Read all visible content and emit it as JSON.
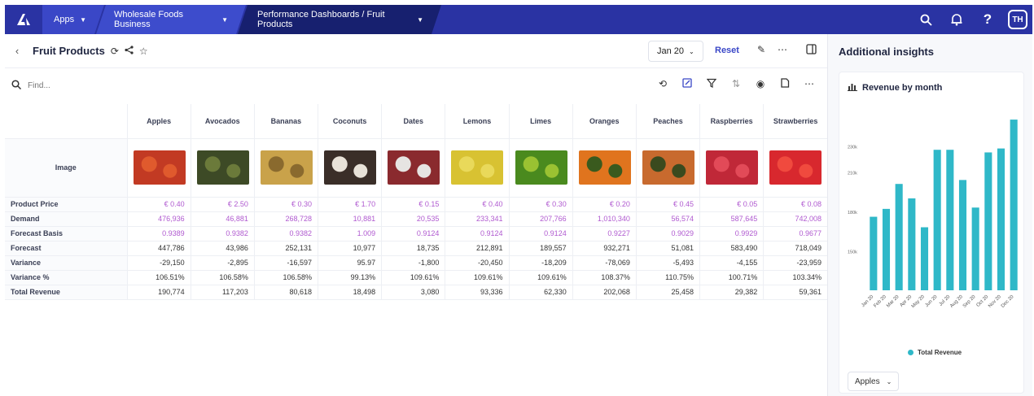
{
  "nav": {
    "apps": "Apps",
    "workspace": "Wholesale Foods Business",
    "dashboard": "Performance Dashboards / Fruit Products",
    "avatar": "TH"
  },
  "header": {
    "title": "Fruit Products",
    "date": "Jan 20",
    "reset": "Reset"
  },
  "toolbar": {
    "find_placeholder": "Find..."
  },
  "grid": {
    "columns": [
      "Apples",
      "Avocados",
      "Bananas",
      "Coconuts",
      "Dates",
      "Lemons",
      "Limes",
      "Oranges",
      "Peaches",
      "Raspberries",
      "Strawberries"
    ],
    "image_label": "Image",
    "image_colors": [
      [
        "#c23a23",
        "#e05a2d"
      ],
      [
        "#3d4a26",
        "#6b7a3a"
      ],
      [
        "#c9a24a",
        "#8a6a2e"
      ],
      [
        "#3a2e28",
        "#e8e2d8"
      ],
      [
        "#8a2a2e",
        "#e6e4e2"
      ],
      [
        "#d8c232",
        "#e9d95a"
      ],
      [
        "#4a8a1e",
        "#9ac232"
      ],
      [
        "#e0741e",
        "#3a5a1e"
      ],
      [
        "#c86a2e",
        "#3a4a1e"
      ],
      [
        "#c02838",
        "#e24a58"
      ],
      [
        "#d8282e",
        "#f04a3e"
      ]
    ],
    "rows": [
      {
        "label": "Product Price",
        "purple": true,
        "values": [
          "€ 0.40",
          "€ 2.50",
          "€ 0.30",
          "€ 1.70",
          "€ 0.15",
          "€ 0.40",
          "€ 0.30",
          "€ 0.20",
          "€ 0.45",
          "€ 0.05",
          "€ 0.08"
        ]
      },
      {
        "label": "Demand",
        "purple": true,
        "values": [
          "476,936",
          "46,881",
          "268,728",
          "10,881",
          "20,535",
          "233,341",
          "207,766",
          "1,010,340",
          "56,574",
          "587,645",
          "742,008"
        ]
      },
      {
        "label": "Forecast Basis",
        "purple": true,
        "values": [
          "0.9389",
          "0.9382",
          "0.9382",
          "1.009",
          "0.9124",
          "0.9124",
          "0.9124",
          "0.9227",
          "0.9029",
          "0.9929",
          "0.9677"
        ]
      },
      {
        "label": "Forecast",
        "purple": false,
        "values": [
          "447,786",
          "43,986",
          "252,131",
          "10,977",
          "18,735",
          "212,891",
          "189,557",
          "932,271",
          "51,081",
          "583,490",
          "718,049"
        ]
      },
      {
        "label": "Variance",
        "purple": false,
        "values": [
          "-29,150",
          "-2,895",
          "-16,597",
          "95.97",
          "-1,800",
          "-20,450",
          "-18,209",
          "-78,069",
          "-5,493",
          "-4,155",
          "-23,959"
        ]
      },
      {
        "label": "Variance %",
        "purple": false,
        "values": [
          "106.51%",
          "106.58%",
          "106.58%",
          "99.13%",
          "109.61%",
          "109.61%",
          "109.61%",
          "108.37%",
          "110.75%",
          "100.71%",
          "103.34%"
        ]
      },
      {
        "label": "Total Revenue",
        "purple": false,
        "values": [
          "190,774",
          "117,203",
          "80,618",
          "18,498",
          "3,080",
          "93,336",
          "62,330",
          "202,068",
          "25,458",
          "29,382",
          "59,361"
        ]
      }
    ]
  },
  "insights": {
    "title": "Additional insights",
    "card_title": "Revenue by month",
    "fruit_select": "Apples"
  },
  "chart_data": {
    "type": "bar",
    "title": "Revenue by month",
    "categories": [
      "Jan 20",
      "Feb 20",
      "Mar 20",
      "Apr 20",
      "May 20",
      "Jun 20",
      "Jul 20",
      "Aug 20",
      "Sep 20",
      "Oct 20",
      "Nov 20",
      "Dec 20"
    ],
    "series": [
      {
        "name": "Total Revenue",
        "values": [
          176,
          182,
          201,
          190,
          168,
          227,
          227,
          204,
          183,
          225,
          228,
          250
        ]
      }
    ],
    "yticks": [
      150,
      180,
      210,
      230
    ],
    "ytick_labels": [
      "150k",
      "180k",
      "210k",
      "230k"
    ],
    "ylim": [
      120,
      255
    ],
    "bar_color": "#2fb8c8",
    "legend": "bottom",
    "grid": false
  }
}
